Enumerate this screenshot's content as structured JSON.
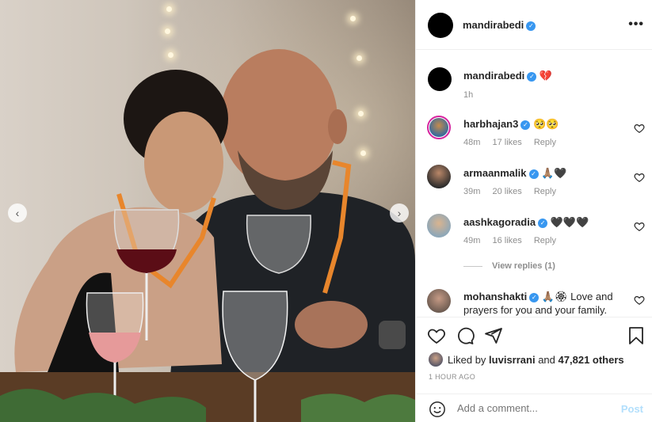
{
  "header": {
    "username": "mandirabedi",
    "more_label": "•••"
  },
  "caption": {
    "username": "mandirabedi",
    "emoji": "💔",
    "time": "1h"
  },
  "comments": [
    {
      "username": "harbhajan3",
      "text": "🥺🥺",
      "time": "48m",
      "likes": "17 likes",
      "reply": "Reply"
    },
    {
      "username": "armaanmalik",
      "text": "🙏🏽🖤",
      "time": "39m",
      "likes": "20 likes",
      "reply": "Reply"
    },
    {
      "username": "aashkagoradia",
      "text": "🖤🖤🖤",
      "time": "49m",
      "likes": "16 likes",
      "reply": "Reply",
      "view_replies": "View replies (1)"
    },
    {
      "username": "mohanshakti",
      "text": "🙏🏽🏵 Love and prayers for you and your family."
    }
  ],
  "likes": {
    "prefix": "Liked by",
    "user": "luvisrrani",
    "joiner": "and",
    "count": "47,821 others"
  },
  "posted": "1 HOUR AGO",
  "add_comment": {
    "placeholder": "Add a comment...",
    "post_label": "Post"
  },
  "icons": [
    "heart-icon",
    "comment-icon",
    "share-icon",
    "bookmark-icon",
    "emoji-icon",
    "verified-icon",
    "chevron-left-icon",
    "chevron-right-icon"
  ],
  "colors": {
    "verified": "#3897f0",
    "muted": "#8e8e8e",
    "post_button": "#b2dffc"
  }
}
